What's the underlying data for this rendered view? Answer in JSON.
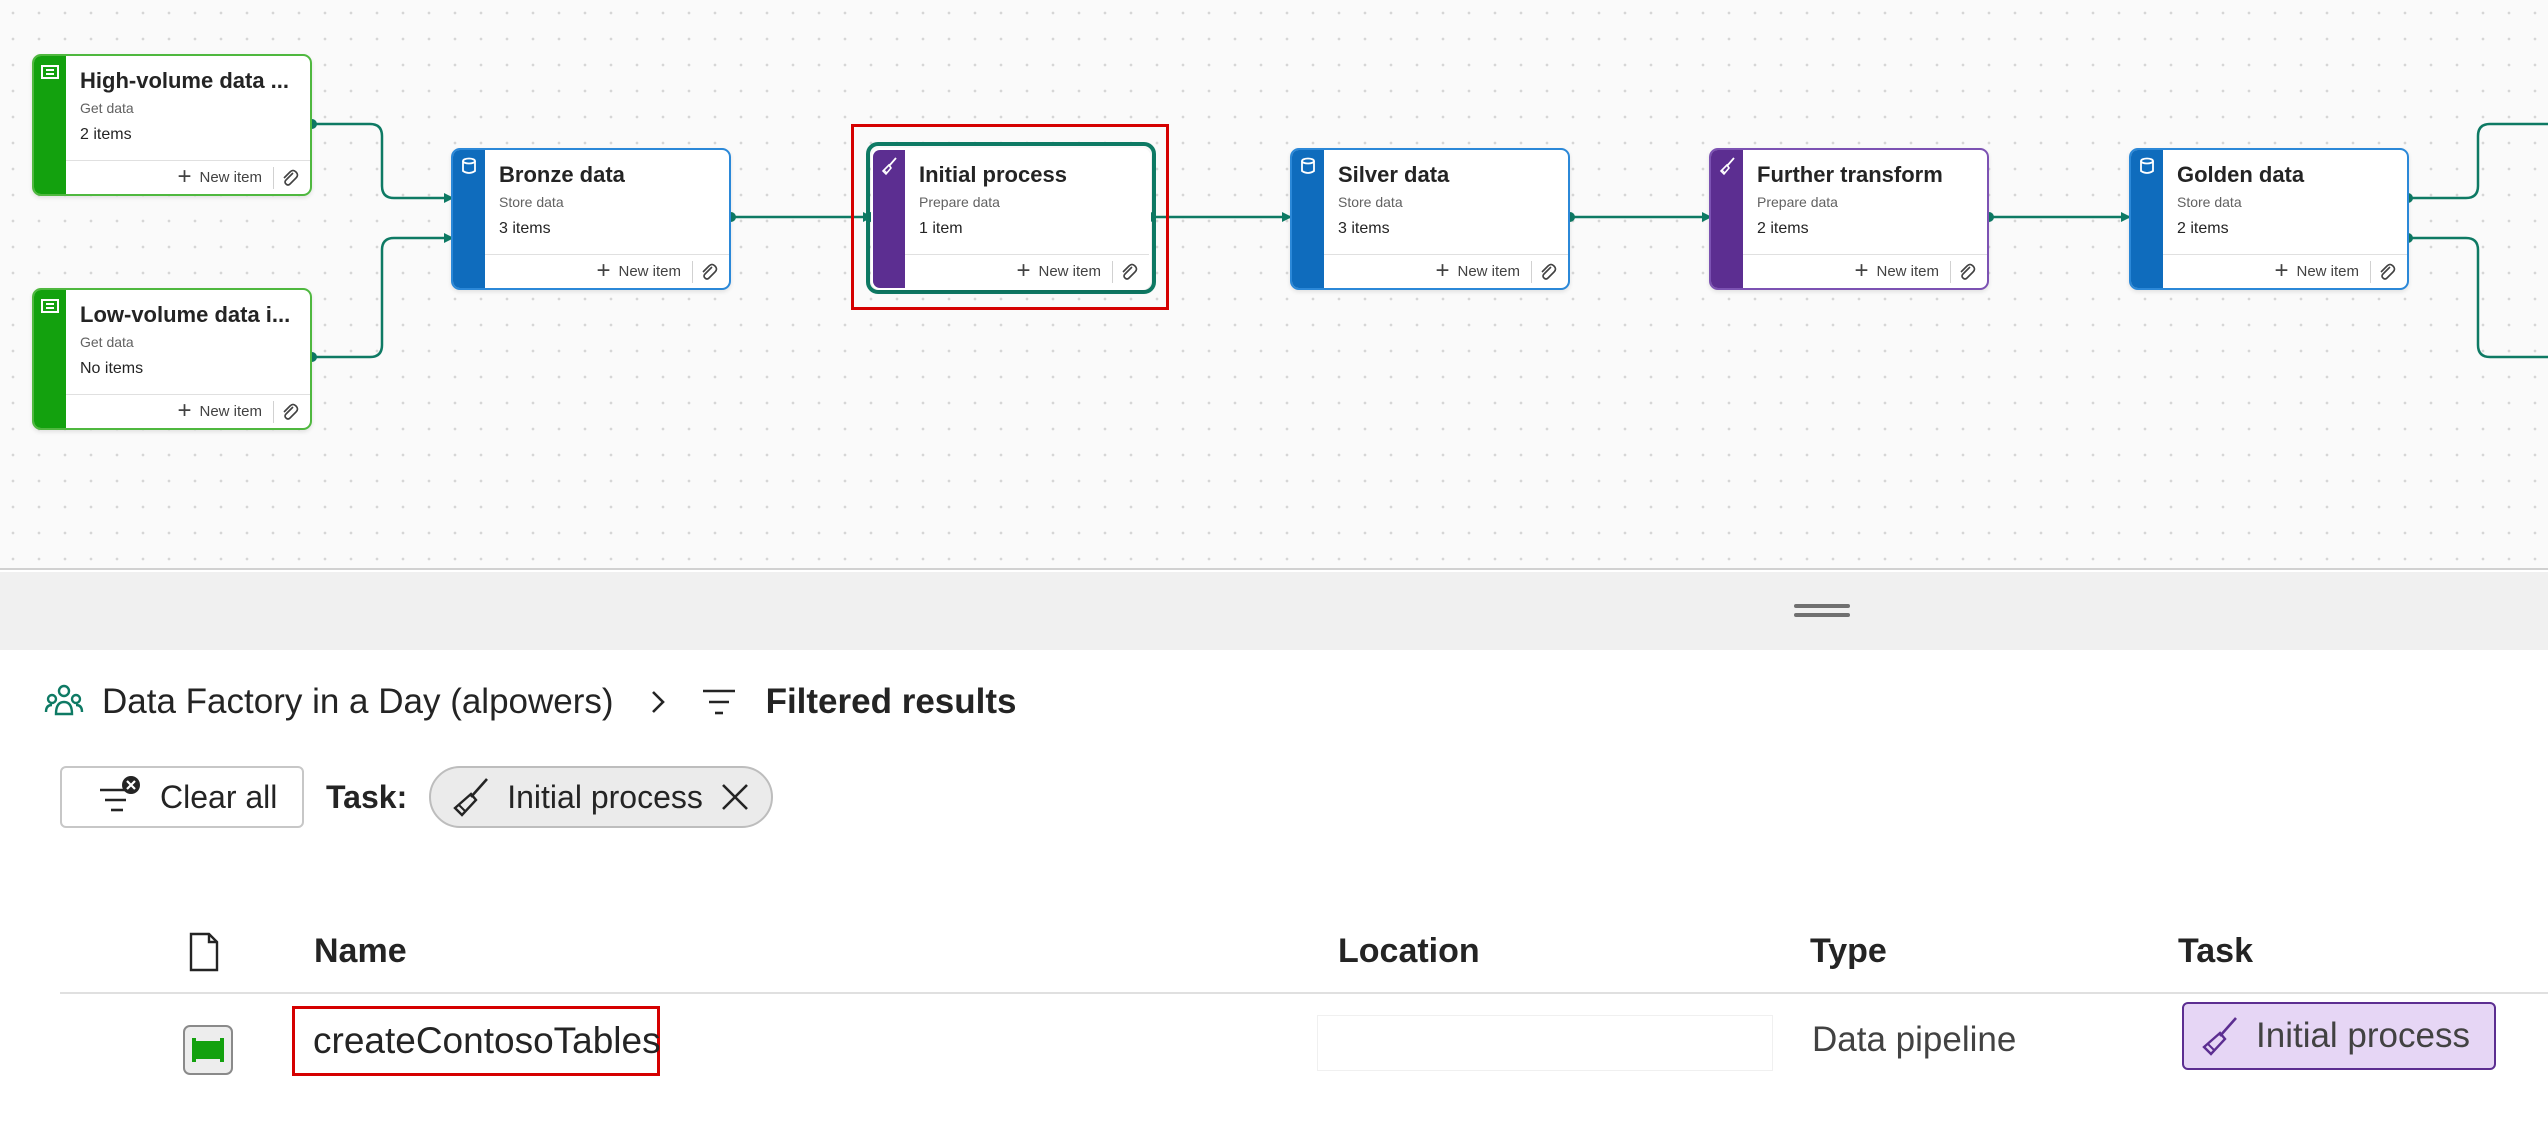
{
  "canvas": {
    "nodes": [
      {
        "id": "high-volume",
        "title": "High-volume data ...",
        "subtitle": "Get data",
        "count": "2 items",
        "new_item": "New item",
        "color": "green",
        "icon": "pipeline-icon"
      },
      {
        "id": "low-volume",
        "title": "Low-volume data i...",
        "subtitle": "Get data",
        "count": "No items",
        "new_item": "New item",
        "color": "green",
        "icon": "pipeline-icon"
      },
      {
        "id": "bronze",
        "title": "Bronze data",
        "subtitle": "Store data",
        "count": "3 items",
        "new_item": "New item",
        "color": "blue",
        "icon": "database-icon"
      },
      {
        "id": "initial",
        "title": "Initial process",
        "subtitle": "Prepare data",
        "count": "1 item",
        "new_item": "New item",
        "color": "purple",
        "icon": "brush-icon",
        "selected": true
      },
      {
        "id": "silver",
        "title": "Silver data",
        "subtitle": "Store data",
        "count": "3 items",
        "new_item": "New item",
        "color": "blue",
        "icon": "database-icon"
      },
      {
        "id": "further",
        "title": "Further transform",
        "subtitle": "Prepare data",
        "count": "2 items",
        "new_item": "New item",
        "color": "purple",
        "icon": "brush-icon"
      },
      {
        "id": "golden",
        "title": "Golden data",
        "subtitle": "Store data",
        "count": "2 items",
        "new_item": "New item",
        "color": "blue",
        "icon": "database-icon"
      }
    ],
    "colors": {
      "green": "#13a10e",
      "blue": "#0f6cbd",
      "purple": "#5c2e91",
      "connector": "#0e7a64",
      "selection": "#d50000"
    }
  },
  "breadcrumb": {
    "workspace": "Data Factory in a Day (alpowers)",
    "current": "Filtered results"
  },
  "filters": {
    "clear_all": "Clear all",
    "task_label": "Task:",
    "task_value": "Initial process"
  },
  "table": {
    "columns": {
      "name": "Name",
      "location": "Location",
      "type": "Type",
      "task": "Task"
    },
    "rows": [
      {
        "name": "createContosoTables",
        "location": "",
        "type": "Data pipeline",
        "task": "Initial process"
      }
    ]
  }
}
